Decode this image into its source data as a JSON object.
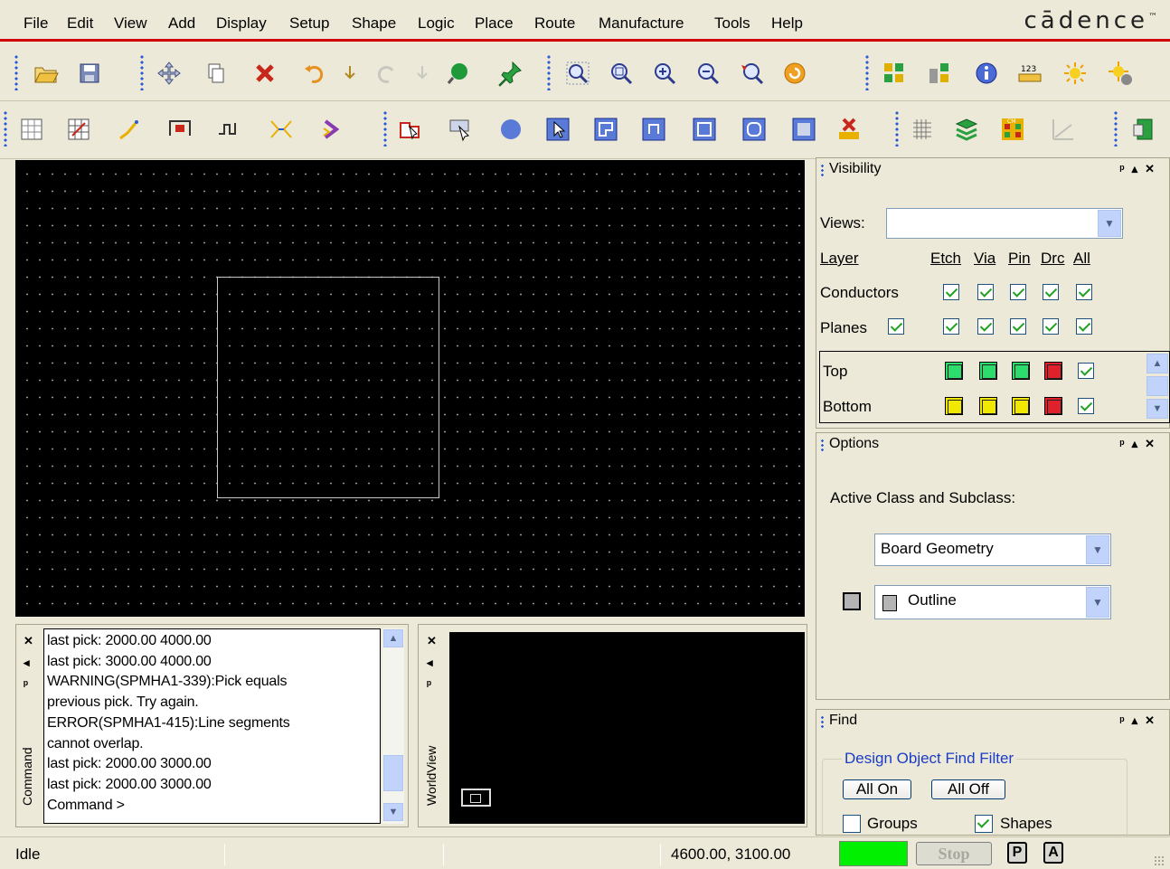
{
  "menu": [
    "File",
    "Edit",
    "View",
    "Add",
    "Display",
    "Setup",
    "Shape",
    "Logic",
    "Place",
    "Route",
    "Manufacture",
    "Tools",
    "Help"
  ],
  "brand": "cādence",
  "brand_tm": "™",
  "visibility": {
    "title": "Visibility",
    "views_label": "Views:",
    "views_value": "",
    "layer_header": "Layer",
    "col_headers": [
      "Etch",
      "Via",
      "Pin",
      "Drc",
      "All"
    ],
    "conductors_label": "Conductors",
    "planes_label": "Planes",
    "layers": [
      {
        "name": "Top",
        "colors": [
          "#2cdc6c",
          "#2cdc6c",
          "#2cdc6c",
          "#e0202a"
        ]
      },
      {
        "name": "Bottom",
        "colors": [
          "#f0e800",
          "#f0e800",
          "#f0e800",
          "#e0202a"
        ]
      }
    ]
  },
  "options": {
    "title": "Options",
    "active_label": "Active Class and Subclass:",
    "class_value": "Board Geometry",
    "subclass_value": "Outline",
    "subclass_color": "#b4b4b4"
  },
  "find": {
    "title": "Find",
    "filter_label": "Design Object Find Filter",
    "all_on": "All On",
    "all_off": "All Off",
    "groups_label": "Groups",
    "shapes_label": "Shapes"
  },
  "command": {
    "vertical_label": "Command",
    "lines": [
      "last pick:  2000.00  4000.00",
      "last pick:  3000.00  4000.00",
      "WARNING(SPMHA1-339):Pick equals",
      "previous pick. Try again.",
      "ERROR(SPMHA1-415):Line segments",
      "cannot overlap.",
      "last pick:  2000.00  3000.00",
      "last pick:  2000.00  3000.00",
      "Command >"
    ]
  },
  "worldview": {
    "vertical_label": "WorldView"
  },
  "status": {
    "state": "Idle",
    "coords": "4600.00, 3100.00",
    "indicator_color": "#00f000",
    "stop_label": "Stop",
    "p_label": "P",
    "a_label": "A"
  }
}
